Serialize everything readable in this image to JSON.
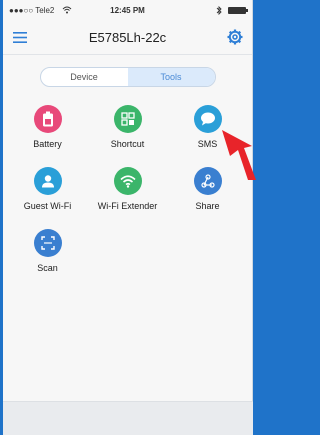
{
  "status_bar": {
    "carrier": "●●●○○ Tele2",
    "time": "12:45 PM"
  },
  "header": {
    "title": "E5785Lh-22c"
  },
  "tabs": [
    {
      "label": "Device"
    },
    {
      "label": "Tools"
    }
  ],
  "tools": [
    {
      "label": "Battery",
      "icon": "battery-icon",
      "color": "#e8497a"
    },
    {
      "label": "Shortcut",
      "icon": "shortcut-icon",
      "color": "#3bb56a"
    },
    {
      "label": "SMS",
      "icon": "sms-icon",
      "color": "#2a9fd8"
    },
    {
      "label": "Guest Wi-Fi",
      "icon": "guest-user-icon",
      "color": "#2a9fd8"
    },
    {
      "label": "Wi-Fi Extender",
      "icon": "wifi-icon",
      "color": "#3bb56a"
    },
    {
      "label": "Share",
      "icon": "share-icon",
      "color": "#3a7fd0"
    },
    {
      "label": "Scan",
      "icon": "scan-icon",
      "color": "#3a7fd0"
    }
  ],
  "colors": {
    "background": "#1f73c9",
    "accent": "#4a8ad6",
    "arrow": "#e8242a"
  }
}
